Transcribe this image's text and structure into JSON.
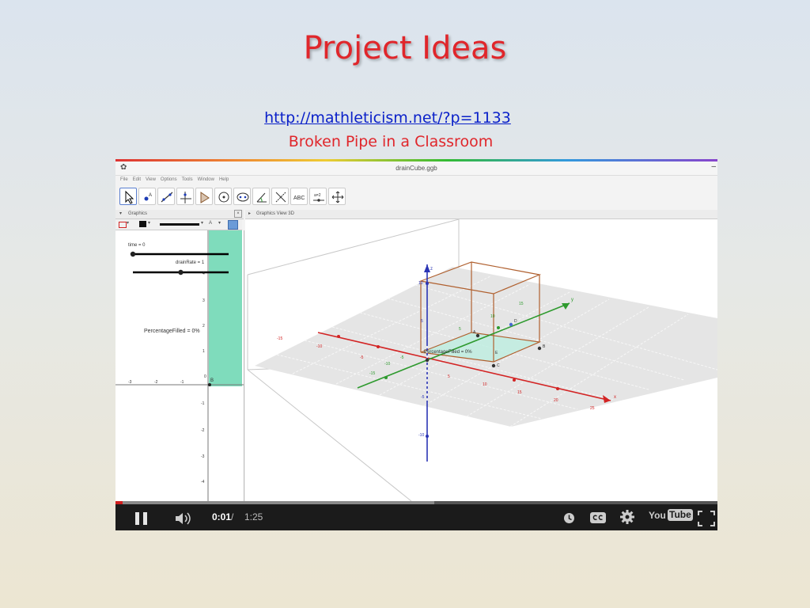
{
  "slide": {
    "title": "Project Ideas",
    "link": "http://mathleticism.net/?p=1133",
    "subtitle": "Broken Pipe in a Classroom"
  },
  "app": {
    "window_title": "drainCube.ggb",
    "menu": [
      "File",
      "Edit",
      "View",
      "Options",
      "Tools",
      "Window",
      "Help"
    ],
    "tool_abc_label": "ABC",
    "tool_slider_label": "a=2",
    "panel_2d_title": "Graphics",
    "panel_3d_title": "Graphics View 3D",
    "style_label_a": "A",
    "slider_time_label": "time = 0",
    "slider_drain_label": "drainRate = 1",
    "slider_time_value": 0,
    "slider_drain_fraction": 0.5,
    "percentage_2d": "PercentageFilled = 0%",
    "percentage_3d": "PercentageFilled = 0%",
    "axis_2d_x_ticks": [
      "-3",
      "-2",
      "-1",
      "0"
    ],
    "axis_2d_y_ticks": [
      "4",
      "3",
      "2",
      "1",
      "0",
      "-1",
      "-2",
      "-3",
      "-4"
    ],
    "point_label_2d": "B",
    "axis_3d_x_ticks": [
      "-15",
      "-10",
      "-5",
      "5",
      "10",
      "15",
      "20",
      "25"
    ],
    "axis_3d_y_ticks": [
      "-15",
      "-10",
      "-5",
      "5",
      "10",
      "15"
    ],
    "axis_3d_z_ticks": [
      "10",
      "5",
      "-5",
      "-10"
    ],
    "axis_labels_3d": {
      "y": "y",
      "x": "x",
      "z": "z"
    },
    "point_labels_3d": {
      "a": "A",
      "b": "B",
      "c": "C",
      "d": "D",
      "e": "E"
    }
  },
  "player": {
    "current_time": "0:01",
    "separator": "/",
    "total_time": "1:25",
    "logo_you": "You",
    "logo_tube": "Tube",
    "played_fraction": 0.012,
    "buffered_fraction": 0.53,
    "icons": [
      "pause-icon",
      "volume-icon",
      "watch-later-icon",
      "captions-icon",
      "settings-icon",
      "fullscreen-icon"
    ],
    "accent_color": "#d01f1f"
  },
  "colors": {
    "title": "#e0262b",
    "link": "#0b21c9",
    "fill": "#7fdcbc",
    "axis_x": "#d32424",
    "axis_y": "#2e9a2e",
    "axis_z": "#2b35b5",
    "cube": "#b0602f"
  }
}
